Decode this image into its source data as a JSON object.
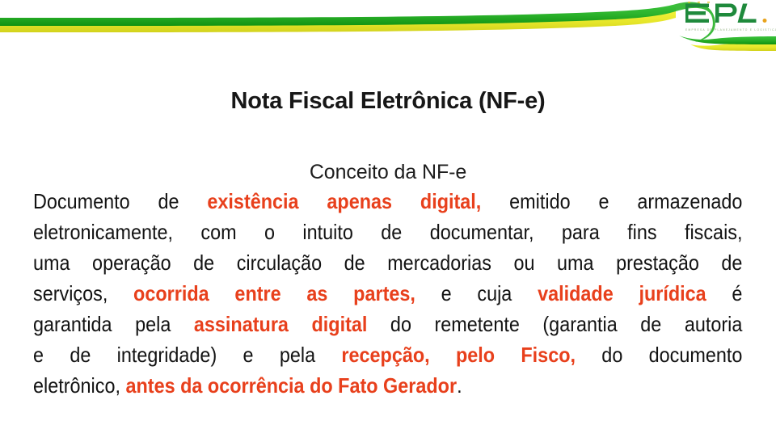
{
  "brand": {
    "logo_text": "EPL",
    "logo_tagline": "EMPRESA DE PLANEJAMENTO E LOGISTICA",
    "colors": {
      "green": "#2db42d",
      "green_dark": "#159415",
      "yellow": "#e8e82a",
      "logo_green": "#1f8a3c",
      "accent_red": "#e8401c",
      "text_black": "#131313"
    }
  },
  "slide": {
    "title": "Nota Fiscal Eletrônica (NF-e)",
    "subtitle": "Conceito da NF-e",
    "paragraph_full": "Documento de existência apenas digital, emitido e armazenado eletronicamente, com o intuito de documentar, para fins fiscais, uma operação de circulação de mercadorias ou uma prestação de serviços, ocorrida entre as partes, e cuja validade jurídica é garantida pela assinatura digital do remetente (garantia de autoria e de integridade) e pela recepção, pelo Fisco, do documento eletrônico, antes da ocorrência do Fato Gerador.",
    "lines": [
      {
        "id": "line-1",
        "segments": [
          {
            "text": "Documento",
            "highlight": false
          },
          {
            "text": "de",
            "highlight": false
          },
          {
            "text": "existência",
            "highlight": true
          },
          {
            "text": "apenas",
            "highlight": true
          },
          {
            "text": "digital,",
            "highlight": true,
            "trailing_plain": ","
          },
          {
            "text": "emitido",
            "highlight": false
          },
          {
            "text": "e",
            "highlight": false
          },
          {
            "text": "armazenado",
            "highlight": false
          }
        ]
      },
      {
        "id": "line-2",
        "segments": [
          {
            "text": "eletronicamente,",
            "highlight": false
          },
          {
            "text": "com",
            "highlight": false
          },
          {
            "text": "o",
            "highlight": false
          },
          {
            "text": "intuito",
            "highlight": false
          },
          {
            "text": "de",
            "highlight": false
          },
          {
            "text": "documentar,",
            "highlight": false
          },
          {
            "text": "para",
            "highlight": false
          },
          {
            "text": "fins",
            "highlight": false
          },
          {
            "text": "fiscais,",
            "highlight": false
          }
        ]
      },
      {
        "id": "line-3",
        "segments": [
          {
            "text": "uma",
            "highlight": false
          },
          {
            "text": "operação",
            "highlight": false
          },
          {
            "text": "de",
            "highlight": false
          },
          {
            "text": "circulação",
            "highlight": false
          },
          {
            "text": "de",
            "highlight": false
          },
          {
            "text": "mercadorias",
            "highlight": false
          },
          {
            "text": "ou",
            "highlight": false
          },
          {
            "text": "uma",
            "highlight": false
          },
          {
            "text": "prestação",
            "highlight": false
          },
          {
            "text": "de",
            "highlight": false
          }
        ]
      },
      {
        "id": "line-4",
        "segments": [
          {
            "text": "serviços,",
            "highlight": false
          },
          {
            "text": "ocorrida",
            "highlight": true
          },
          {
            "text": "entre",
            "highlight": true
          },
          {
            "text": "as",
            "highlight": true
          },
          {
            "text": "partes,",
            "highlight": true
          },
          {
            "text": "e",
            "highlight": false
          },
          {
            "text": "cuja",
            "highlight": false
          },
          {
            "text": "validade",
            "highlight": true
          },
          {
            "text": "jurídica",
            "highlight": true
          },
          {
            "text": "é",
            "highlight": false
          }
        ]
      },
      {
        "id": "line-5",
        "segments": [
          {
            "text": "garantida",
            "highlight": false
          },
          {
            "text": "pela",
            "highlight": false
          },
          {
            "text": "assinatura",
            "highlight": true
          },
          {
            "text": "digital",
            "highlight": true
          },
          {
            "text": "do",
            "highlight": false
          },
          {
            "text": "remetente",
            "highlight": false
          },
          {
            "text": "(garantia",
            "highlight": false
          },
          {
            "text": "de",
            "highlight": false
          },
          {
            "text": "autoria",
            "highlight": false
          }
        ]
      },
      {
        "id": "line-6",
        "segments": [
          {
            "text": "e",
            "highlight": false
          },
          {
            "text": "de",
            "highlight": false
          },
          {
            "text": "integridade)",
            "highlight": false
          },
          {
            "text": "e",
            "highlight": false
          },
          {
            "text": "pela",
            "highlight": false
          },
          {
            "text": "recepção,",
            "highlight": true
          },
          {
            "text": "pelo",
            "highlight": true
          },
          {
            "text": "Fisco,",
            "highlight": true
          },
          {
            "text": "do",
            "highlight": false
          },
          {
            "text": "documento",
            "highlight": false
          }
        ]
      },
      {
        "id": "line-7",
        "last": true,
        "segments": [
          {
            "text": "eletrônico,",
            "highlight": false
          },
          {
            "text": " ",
            "highlight": false
          },
          {
            "text": "antes da ocorrência do Fato Gerador",
            "highlight": true
          },
          {
            "text": ".",
            "highlight": false
          }
        ]
      }
    ]
  }
}
